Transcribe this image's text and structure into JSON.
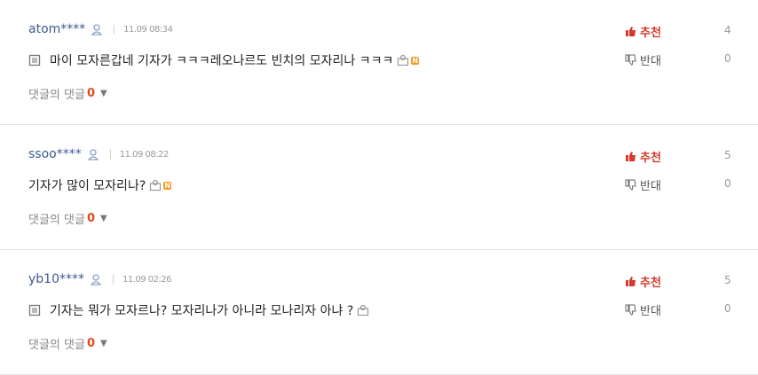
{
  "comments": [
    {
      "username": "atom****",
      "date": "11.09 08:34",
      "text": "마이 모자른갑네 기자가 ㅋㅋㅋ레오나르도 빈치의 모자리나 ㅋㅋㅋ",
      "reply_label": "댓글의 댓글",
      "reply_count": "0",
      "up_label": "추천",
      "up_count": "4",
      "down_label": "반대",
      "down_count": "0"
    },
    {
      "username": "ssoo****",
      "date": "11.09 08:22",
      "text": "기자가 많이 모자리나?",
      "reply_label": "댓글의 댓글",
      "reply_count": "0",
      "up_label": "추천",
      "up_count": "5",
      "down_label": "반대",
      "down_count": "0"
    },
    {
      "username": "yb10****",
      "date": "11.09 02:26",
      "text": "기자는 뭐가 모자르나? 모자리나가 아니라 모나리자 아냐 ?",
      "reply_label": "댓글의 댓글",
      "reply_count": "0",
      "up_label": "추천",
      "up_count": "5",
      "down_label": "반대",
      "down_count": "0"
    }
  ]
}
